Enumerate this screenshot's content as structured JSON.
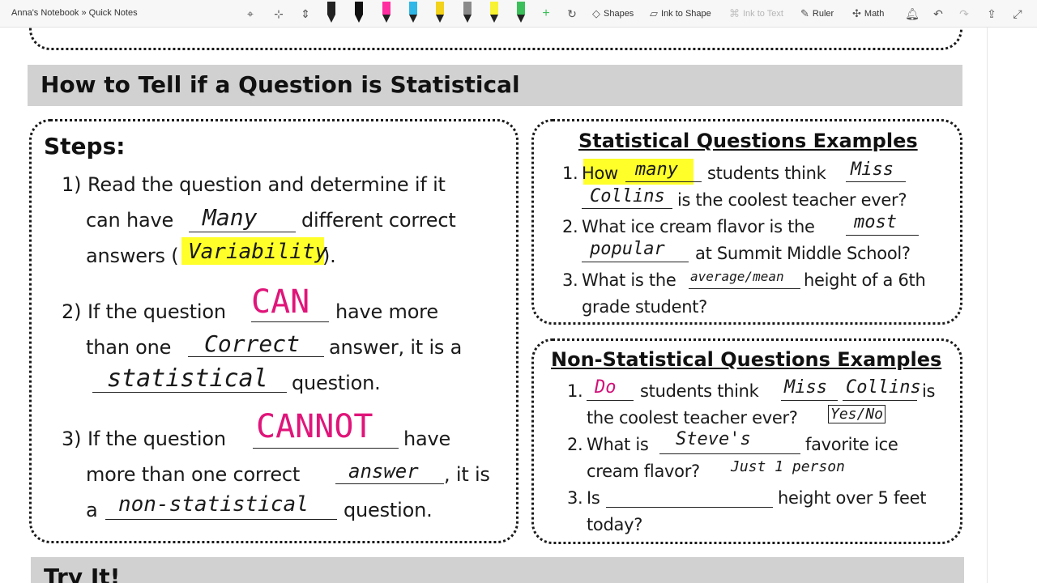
{
  "toolbar": {
    "breadcrumb": "Anna's Notebook » Quick Notes",
    "shapes": "Shapes",
    "ink_to_shape": "Ink to Shape",
    "ink_to_text": "Ink to Text",
    "ruler": "Ruler",
    "math": "Math",
    "pen_colors": [
      "#222222",
      "#111111",
      "#ff2da0",
      "#2fb7e8",
      "#f2d21b",
      "#8a8a8a",
      "#f7f233",
      "#3bbf5a"
    ]
  },
  "section1": {
    "title": "How to Tell if a Question is Statistical"
  },
  "steps": {
    "heading": "Steps:",
    "s1_num": "1)",
    "s1_a": "Read the question and determine if it",
    "s1_b": "can have",
    "s1_b_fill": "Many",
    "s1_c": "different correct",
    "s1_d": "answers (",
    "s1_d_fill": "Variability",
    "s1_e": ").",
    "s2_num": "2)",
    "s2_a": "If the question",
    "s2_a_fill": "CAN",
    "s2_b": "have more",
    "s2_c": "than one",
    "s2_c_fill": "Correct",
    "s2_d": "answer, it is a",
    "s2_e_fill": "statistical",
    "s2_f": "question.",
    "s3_num": "3)",
    "s3_a": "If the question",
    "s3_a_fill": "CANNOT",
    "s3_b": "have",
    "s3_c": "more than one correct",
    "s3_c_fill": "answer",
    "s3_d": ", it is",
    "s3_e": "a",
    "s3_e_fill": "non-statistical",
    "s3_f": "question."
  },
  "stat_examples": {
    "heading": "Statistical Questions Examples",
    "e1_num": "1.",
    "e1_a": "How",
    "e1_a_fill": "many",
    "e1_b": "students think",
    "e1_b_fill": "Miss",
    "e1_c_fill": "Collins",
    "e1_c": "is the coolest teacher ever?",
    "e2_num": "2.",
    "e2_a": "What ice cream flavor is the",
    "e2_a_fill": "most",
    "e2_b_fill": "popular",
    "e2_b": "at Summit Middle School?",
    "e3_num": "3.",
    "e3_a": "What is the",
    "e3_a_fill": "average/mean",
    "e3_b": "height of a 6th",
    "e3_c": "grade student?"
  },
  "nonstat_examples": {
    "heading": "Non-Statistical Questions Examples",
    "e1_num": "1.",
    "e1_a_fill": "Do",
    "e1_a": "students think",
    "e1_b_fill": "Miss",
    "e1_c_fill": "Collins",
    "e1_b": "is",
    "e1_c": "the coolest teacher ever?",
    "e1_note": "Yes/No",
    "e2_num": "2.",
    "e2_a": "What is",
    "e2_a_fill": "Steve's",
    "e2_b": "favorite ice",
    "e2_c": "cream flavor?",
    "e2_note": "Just 1 person",
    "e3_num": "3.",
    "e3_a": "Is",
    "e3_b": "height over 5 feet",
    "e3_c": "today?"
  },
  "section2": {
    "title": "Try It!"
  }
}
